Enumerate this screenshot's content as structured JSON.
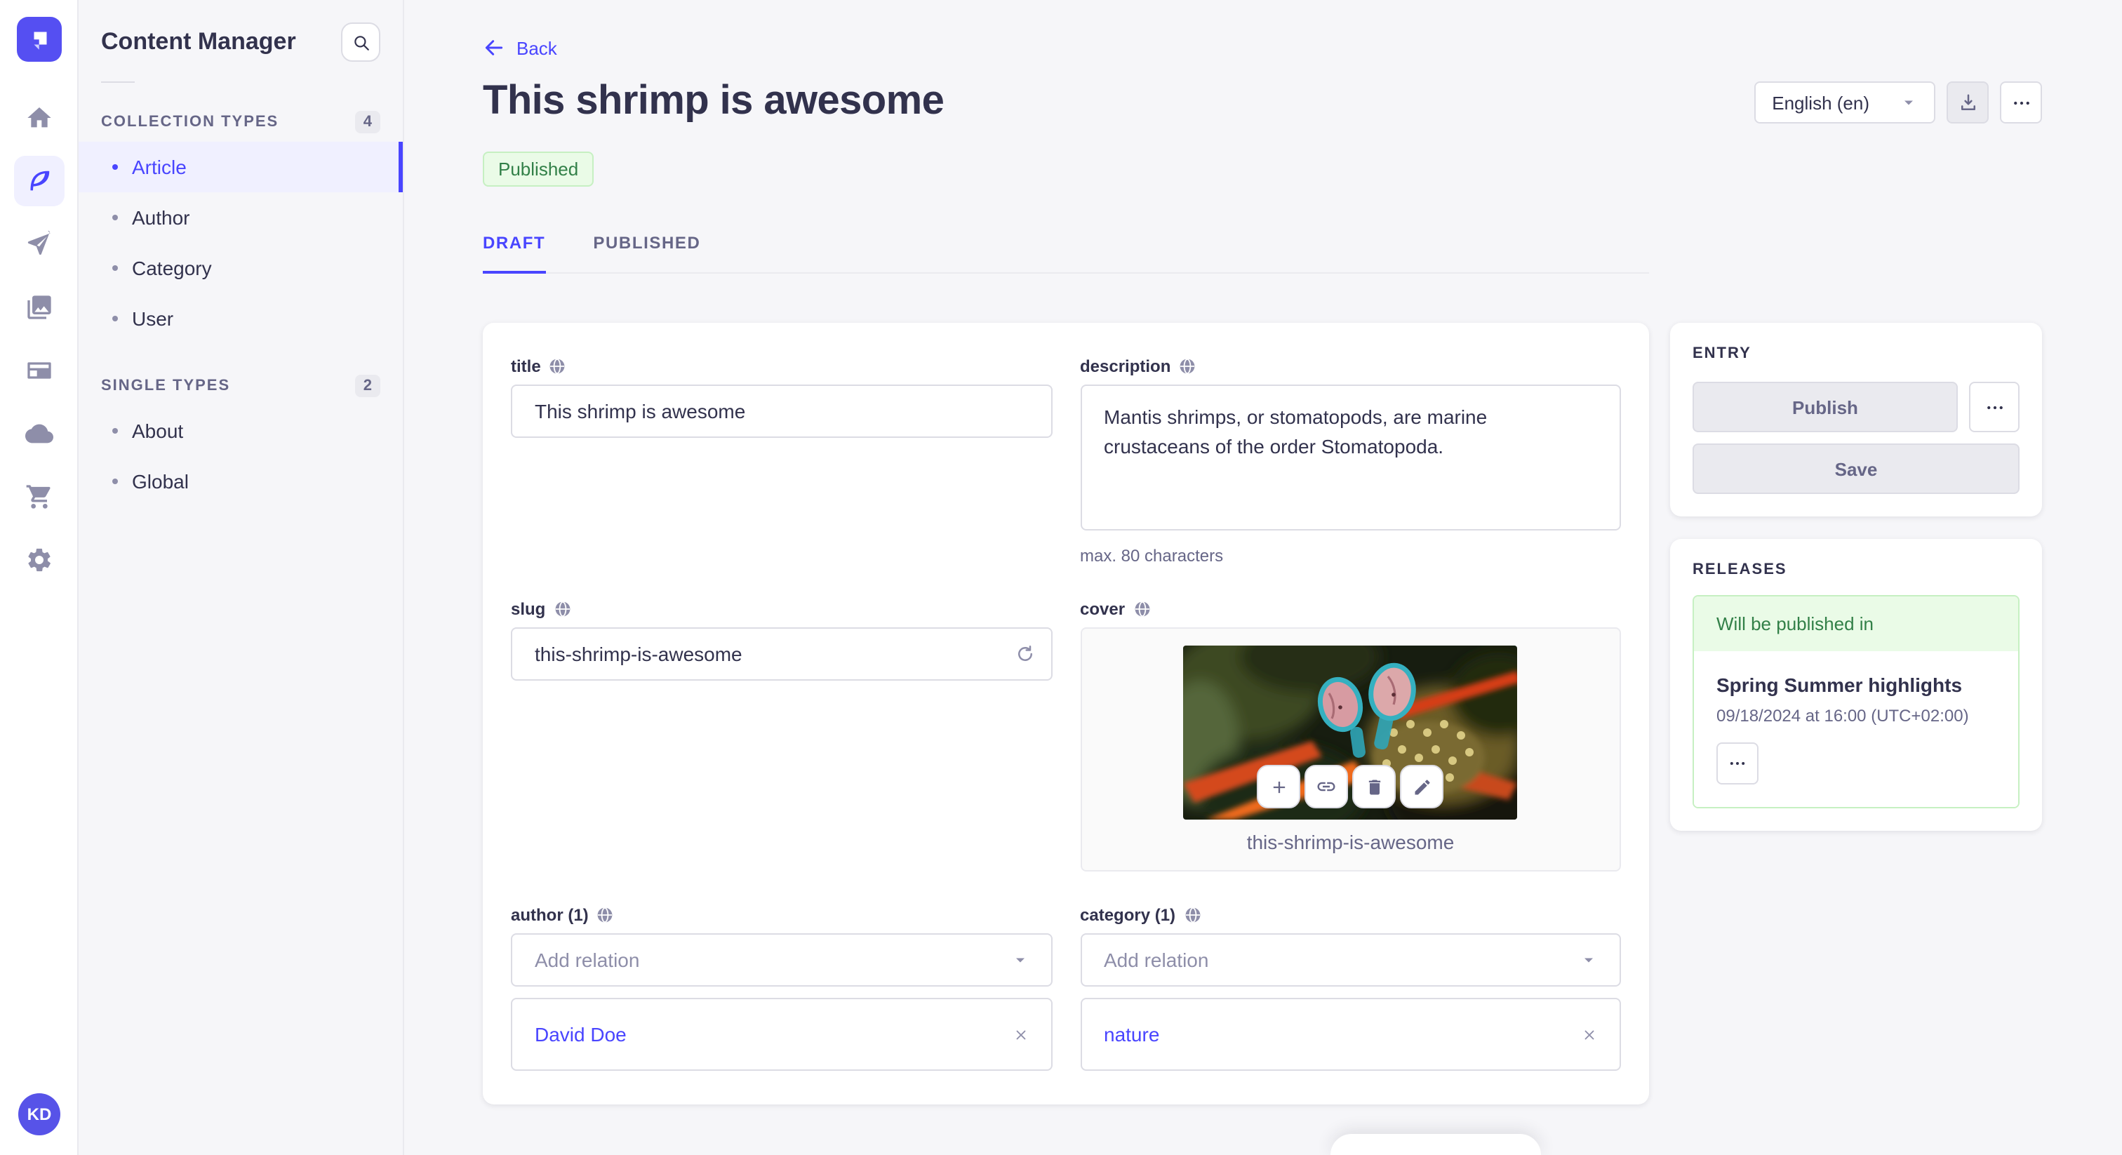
{
  "accent_color": "#4945ff",
  "subnav": {
    "title": "Content Manager",
    "sections": [
      {
        "label": "COLLECTION TYPES",
        "count": "4",
        "items": [
          {
            "label": "Article"
          },
          {
            "label": "Author"
          },
          {
            "label": "Category"
          },
          {
            "label": "User"
          }
        ]
      },
      {
        "label": "SINGLE TYPES",
        "count": "2",
        "items": [
          {
            "label": "About"
          },
          {
            "label": "Global"
          }
        ]
      }
    ]
  },
  "header": {
    "back_label": "Back",
    "title": "This shrimp is awesome",
    "status_badge": "Published",
    "locale_select": "English (en)",
    "tabs": [
      {
        "label": "DRAFT"
      },
      {
        "label": "PUBLISHED"
      }
    ]
  },
  "form": {
    "title": {
      "label": "title",
      "value": "This shrimp is awesome"
    },
    "description": {
      "label": "description",
      "value": "Mantis shrimps, or stomatopods, are marine crustaceans of the order Stomatopoda.",
      "hint": "max. 80 characters"
    },
    "slug": {
      "label": "slug",
      "value": "this-shrimp-is-awesome"
    },
    "cover": {
      "label": "cover",
      "caption": "this-shrimp-is-awesome"
    },
    "author": {
      "label": "author (1)",
      "placeholder": "Add relation",
      "relation": "David Doe"
    },
    "category": {
      "label": "category (1)",
      "placeholder": "Add relation",
      "relation": "nature"
    }
  },
  "entry_panel": {
    "title": "ENTRY",
    "publish_label": "Publish",
    "save_label": "Save"
  },
  "releases_panel": {
    "title": "RELEASES",
    "status": "Will be published in",
    "release_name": "Spring Summer highlights",
    "release_date": "09/18/2024 at 16:00 (UTC+02:00)"
  },
  "avatar": {
    "initials": "KD"
  },
  "status_colors": {
    "published_text": "#328048",
    "published_bg": "#eafbe7",
    "published_border": "#c6f0c2"
  }
}
